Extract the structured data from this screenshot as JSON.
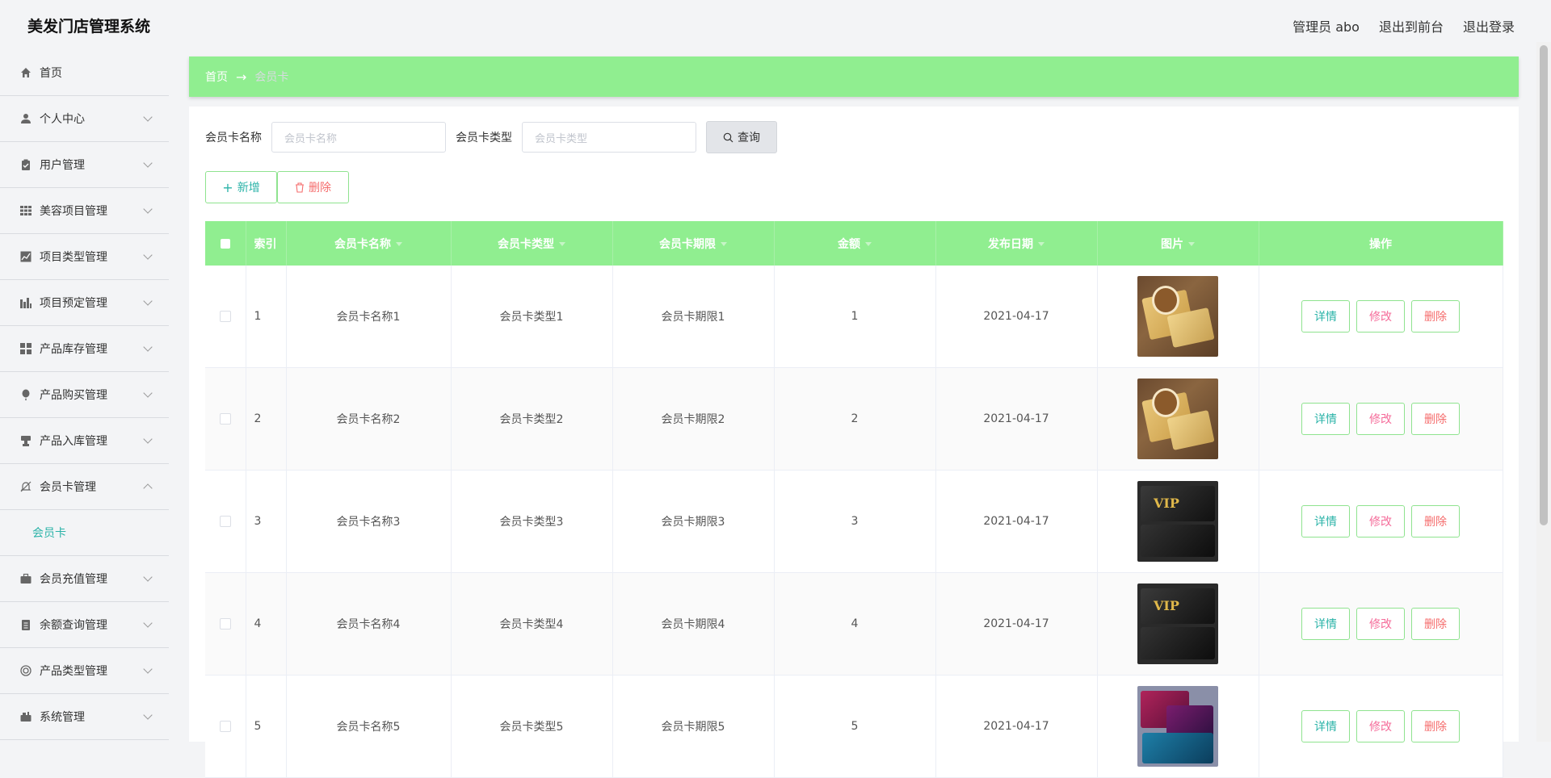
{
  "header": {
    "app_title": "美发门店管理系统",
    "user_label": "管理员 abo",
    "to_frontend": "退出到前台",
    "logout": "退出登录"
  },
  "sidebar": {
    "items": [
      {
        "label": "首页",
        "icon": "home-icon"
      },
      {
        "label": "个人中心",
        "icon": "user-icon"
      },
      {
        "label": "用户管理",
        "icon": "clipboard-icon"
      },
      {
        "label": "美容项目管理",
        "icon": "grid-icon"
      },
      {
        "label": "项目类型管理",
        "icon": "chart-icon"
      },
      {
        "label": "项目预定管理",
        "icon": "bar-chart-icon"
      },
      {
        "label": "产品库存管理",
        "icon": "apps-icon"
      },
      {
        "label": "产品购买管理",
        "icon": "balloon-icon"
      },
      {
        "label": "产品入库管理",
        "icon": "stamp-icon"
      },
      {
        "label": "会员卡管理",
        "icon": "bell-off-icon"
      },
      {
        "label": "会员卡",
        "icon": ""
      },
      {
        "label": "会员充值管理",
        "icon": "briefcase-icon"
      },
      {
        "label": "余额查询管理",
        "icon": "notebook-icon"
      },
      {
        "label": "产品类型管理",
        "icon": "lifebuoy-icon"
      },
      {
        "label": "系统管理",
        "icon": "camera-icon"
      }
    ]
  },
  "breadcrumb": {
    "home": "首页",
    "arrow": "→",
    "current": "会员卡"
  },
  "search": {
    "name_label": "会员卡名称",
    "name_placeholder": "会员卡名称",
    "type_label": "会员卡类型",
    "type_placeholder": "会员卡类型",
    "query_button": "查询"
  },
  "actions": {
    "add": "新增",
    "delete": "删除"
  },
  "table": {
    "columns": [
      "索引",
      "会员卡名称",
      "会员卡类型",
      "会员卡期限",
      "金额",
      "发布日期",
      "图片",
      "操作"
    ],
    "rows": [
      {
        "index": "1",
        "name": "会员卡名称1",
        "type": "会员卡类型1",
        "term": "会员卡期限1",
        "amount": "1",
        "date": "2021-04-17",
        "image": "gold-vip-card"
      },
      {
        "index": "2",
        "name": "会员卡名称2",
        "type": "会员卡类型2",
        "term": "会员卡期限2",
        "amount": "2",
        "date": "2021-04-17",
        "image": "gold-vip-card"
      },
      {
        "index": "3",
        "name": "会员卡名称3",
        "type": "会员卡类型3",
        "term": "会员卡期限3",
        "amount": "3",
        "date": "2021-04-17",
        "image": "black-vip-card"
      },
      {
        "index": "4",
        "name": "会员卡名称4",
        "type": "会员卡类型4",
        "term": "会员卡期限4",
        "amount": "4",
        "date": "2021-04-17",
        "image": "black-vip-card"
      },
      {
        "index": "5",
        "name": "会员卡名称5",
        "type": "会员卡类型5",
        "term": "会员卡期限5",
        "amount": "5",
        "date": "2021-04-17",
        "image": "purple-blue-card"
      }
    ],
    "row_buttons": {
      "view": "详情",
      "edit": "修改",
      "remove": "删除"
    },
    "vip_text": "VIP"
  },
  "colors": {
    "accent_green": "#90ee90",
    "teal_text": "#2bb3a8",
    "danger": "#f56c6c"
  }
}
